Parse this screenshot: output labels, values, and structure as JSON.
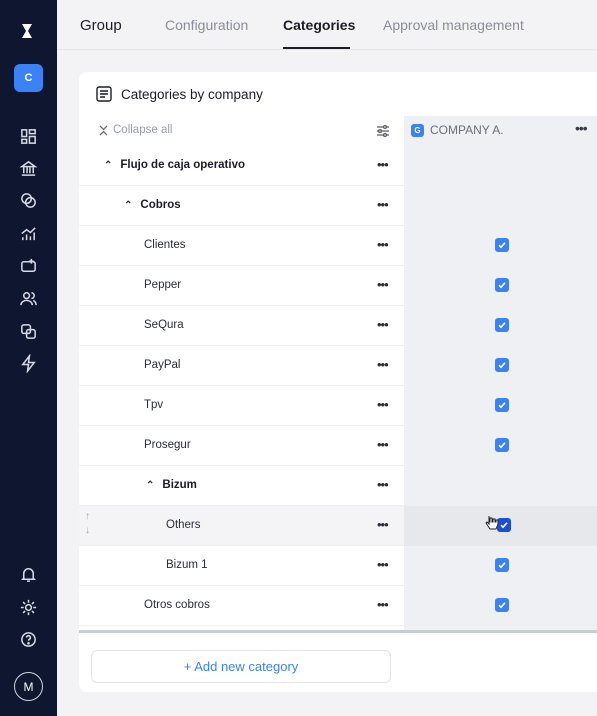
{
  "sidebar": {
    "company_initial": "C",
    "user_initial": "M",
    "nav_icons": [
      "dashboard-icon",
      "bank-icon",
      "coins-icon",
      "chart-icon",
      "wallet-icon",
      "users-icon",
      "copy-icon",
      "bolt-icon"
    ],
    "bottom_icons": [
      "bell-icon",
      "gear-icon",
      "help-icon"
    ]
  },
  "tabs": {
    "group": "Group",
    "configuration": "Configuration",
    "categories": "Categories",
    "approval": "Approval management"
  },
  "card": {
    "title": "Categories by company",
    "collapse_all": "Collapse all",
    "company_name": "COMPANY A.",
    "company_badge": "G",
    "add_new": "+ Add new category"
  },
  "rows": [
    {
      "label": "Flujo de caja operativo",
      "checked": false
    },
    {
      "label": "Cobros",
      "checked": false
    },
    {
      "label": "Clientes",
      "checked": true
    },
    {
      "label": "Pepper",
      "checked": true
    },
    {
      "label": "SeQura",
      "checked": true
    },
    {
      "label": "PayPal",
      "checked": true
    },
    {
      "label": "Tpv",
      "checked": true
    },
    {
      "label": "Prosegur",
      "checked": true
    },
    {
      "label": "Bizum",
      "checked": false
    },
    {
      "label": "Others",
      "checked": true
    },
    {
      "label": "Bizum 1",
      "checked": true
    },
    {
      "label": "Otros cobros",
      "checked": true
    }
  ],
  "colors": {
    "accent": "#3b82f6",
    "sidebar": "#0e1630"
  }
}
